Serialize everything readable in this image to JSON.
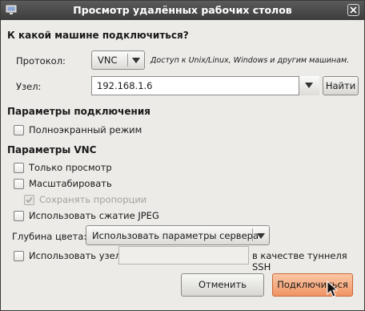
{
  "window": {
    "title": "Просмотр удалённых рабочих столов"
  },
  "connect_section": {
    "heading": "К какой машине подключиться?",
    "protocol_label": "Протокол:",
    "protocol_value": "VNC",
    "protocol_hint": "Доступ к Unix/Linux, Windows и другим машинам.",
    "host_label": "Узел:",
    "host_value": "192.168.1.6",
    "find_button": "Найти"
  },
  "connection_params": {
    "heading": "Параметры подключения",
    "fullscreen_label": "Полноэкранный режим",
    "fullscreen_checked": false
  },
  "vnc_params": {
    "heading": "Параметры VNC",
    "view_only_label": "Только просмотр",
    "view_only_checked": false,
    "scale_label": "Масштабировать",
    "scale_checked": false,
    "keep_ratio_label": "Сохранять пропорции",
    "keep_ratio_checked": true,
    "jpeg_label": "Использовать сжатие JPEG",
    "jpeg_checked": false,
    "depth_label": "Глубина цвета:",
    "depth_value": "Использовать параметры сервера",
    "tunnel_label": "Использовать узел",
    "tunnel_value": "",
    "tunnel_suffix": "в качестве туннеля SSH",
    "tunnel_checked": false
  },
  "buttons": {
    "cancel": "Отменить",
    "connect": "Подключиться"
  },
  "colors": {
    "accent": "#f29a6c",
    "titlebar": "#4a4a4a"
  }
}
